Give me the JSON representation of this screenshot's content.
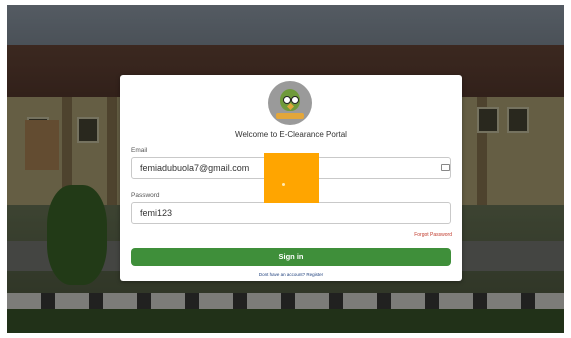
{
  "login": {
    "welcome_text": "Welcome to E-Clearance Portal",
    "email_label": "Email",
    "email_value": "femiadubuola7@gmail.com",
    "password_label": "Password",
    "password_value": "femi123",
    "forgot_password": "Forgot Password",
    "signin_button": "Sign in",
    "register_text": "Dont have an account? Register"
  },
  "colors": {
    "accent_button": "#3f8f3a",
    "forgot_link": "#c0392b",
    "overlay_block": "#ffa500"
  },
  "icons": {
    "logo": "owl-logo-icon",
    "email_field_icon": "card-icon"
  }
}
